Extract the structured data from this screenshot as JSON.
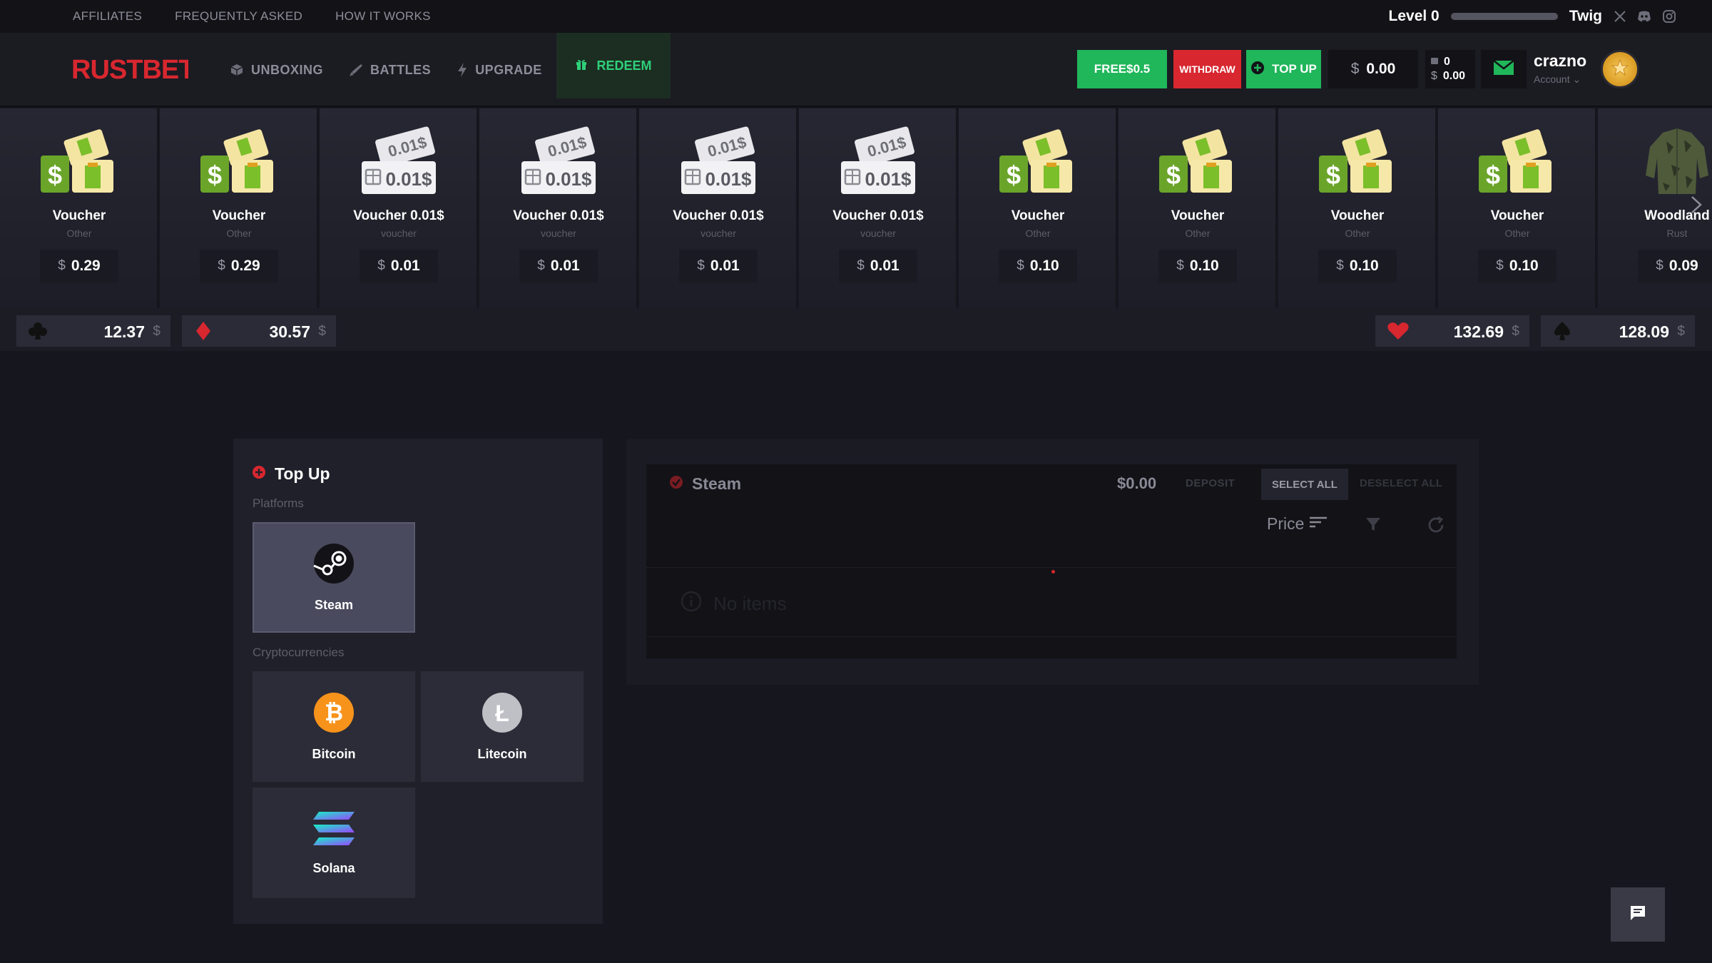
{
  "top_links": [
    "AFFILIATES",
    "FREQUENTLY ASKED",
    "HOW IT WORKS"
  ],
  "level": {
    "label": "Level 0",
    "progress_percent": 0,
    "user": "Twig"
  },
  "social_icons": [
    "x-icon",
    "discord-icon",
    "instagram-icon"
  ],
  "brand": {
    "logo_text": "RUSTBET",
    "accent": "#d8272f"
  },
  "nav": {
    "unboxing": "UNBOXING",
    "battles": "BATTLES",
    "upgrade": "UPGRADE",
    "redeem": "REDEEM"
  },
  "header_actions": {
    "free": "FREE$0.5",
    "withdraw": "WITHDRAW",
    "topup": "TOP UP",
    "balance_currency": "$",
    "balance": "0.00",
    "mini_count": "0",
    "mini_currency": "$",
    "mini_balance": "0.00"
  },
  "account": {
    "name": "crazno",
    "sub": "Account ⌄"
  },
  "items": [
    {
      "name": "Voucher",
      "category": "Other",
      "price": "0.29",
      "icon": "voucher-green"
    },
    {
      "name": "Voucher",
      "category": "Other",
      "price": "0.29",
      "icon": "voucher-green"
    },
    {
      "name": "Voucher 0.01$",
      "category": "voucher",
      "price": "0.01",
      "icon": "voucher-white"
    },
    {
      "name": "Voucher 0.01$",
      "category": "voucher",
      "price": "0.01",
      "icon": "voucher-white"
    },
    {
      "name": "Voucher 0.01$",
      "category": "voucher",
      "price": "0.01",
      "icon": "voucher-white"
    },
    {
      "name": "Voucher 0.01$",
      "category": "voucher",
      "price": "0.01",
      "icon": "voucher-white"
    },
    {
      "name": "Voucher",
      "category": "Other",
      "price": "0.10",
      "icon": "voucher-green"
    },
    {
      "name": "Voucher",
      "category": "Other",
      "price": "0.10",
      "icon": "voucher-green"
    },
    {
      "name": "Voucher",
      "category": "Other",
      "price": "0.10",
      "icon": "voucher-green"
    },
    {
      "name": "Voucher",
      "category": "Other",
      "price": "0.10",
      "icon": "voucher-green"
    },
    {
      "name": "Woodland",
      "category": "Rust",
      "price": "0.09",
      "icon": "jacket"
    }
  ],
  "price_currency": "$",
  "voucher_text": "0.01$",
  "suits": {
    "clubs": {
      "value": "12.37",
      "currency": "$",
      "color": "#111111"
    },
    "diamonds": {
      "value": "30.57",
      "currency": "$",
      "color": "#d8272f"
    },
    "hearts": {
      "value": "132.69",
      "currency": "$",
      "color": "#d8272f"
    },
    "spades": {
      "value": "128.09",
      "currency": "$",
      "color": "#111111"
    }
  },
  "topup_panel": {
    "title": "Top Up",
    "platforms_label": "Platforms",
    "crypto_label": "Cryptocurrencies",
    "platforms": [
      {
        "label": "Steam"
      }
    ],
    "crypto": [
      {
        "label": "Bitcoin"
      },
      {
        "label": "Litecoin"
      },
      {
        "label": "Solana"
      }
    ]
  },
  "steam_panel": {
    "title": "Steam",
    "total": "$0.00",
    "deposit": "DEPOSIT",
    "select_all": "SELECT ALL",
    "deselect_all": "DESELECT ALL",
    "sort_label": "Price",
    "empty": "No items"
  }
}
